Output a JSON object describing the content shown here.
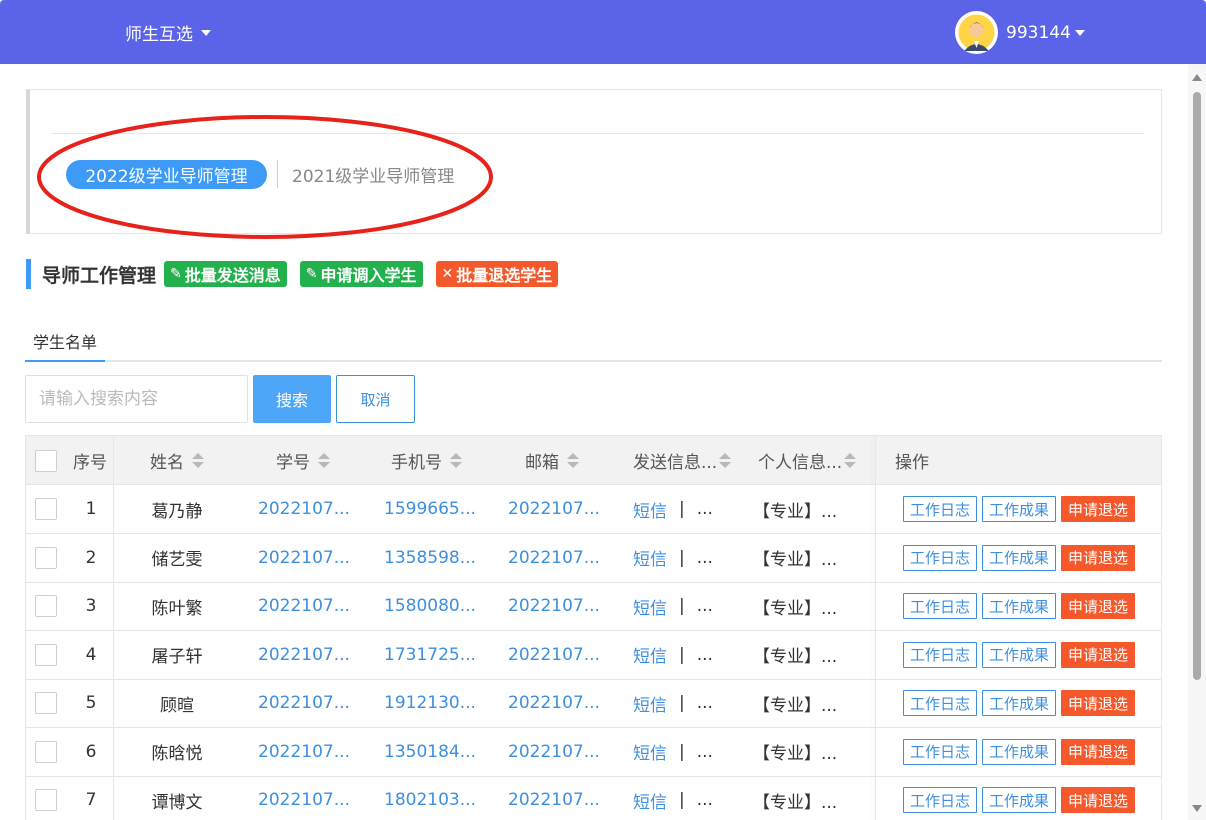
{
  "header": {
    "menu_label": "师生互选",
    "username": "993144",
    "brand_color": "#5b63e8"
  },
  "year_tabs": [
    {
      "label": "2022级学业导师管理",
      "active": true
    },
    {
      "label": "2021级学业导师管理",
      "active": false
    }
  ],
  "section": {
    "title": "导师工作管理",
    "actions": [
      {
        "label": "批量发送消息",
        "icon": "pencil-icon",
        "color": "#22b14c"
      },
      {
        "label": "申请调入学生",
        "icon": "pencil-icon",
        "color": "#22b14c"
      },
      {
        "label": "批量退选学生",
        "icon": "close-icon",
        "color": "#f5582a"
      }
    ]
  },
  "tabs": [
    {
      "label": "学生名单",
      "active": true
    }
  ],
  "search": {
    "placeholder": "请输入搜索内容",
    "value": "",
    "search_label": "搜索",
    "cancel_label": "取消"
  },
  "table": {
    "columns": [
      "序号",
      "姓名",
      "学号",
      "手机号",
      "邮箱",
      "发送信息...",
      "个人信息...",
      "操作"
    ],
    "sortable": [
      "姓名",
      "学号",
      "手机号",
      "邮箱",
      "发送信息...",
      "个人信息..."
    ],
    "rows": [
      {
        "no": "1",
        "name": "葛乃静",
        "student_id": "2022107...",
        "phone": "1599665...",
        "email": "2022107...",
        "msg_link": "短信",
        "msg_sep": "|",
        "msg_more": "...",
        "info": "【专业】..."
      },
      {
        "no": "2",
        "name": "储艺雯",
        "student_id": "2022107...",
        "phone": "1358598...",
        "email": "2022107...",
        "msg_link": "短信",
        "msg_sep": "|",
        "msg_more": "...",
        "info": "【专业】..."
      },
      {
        "no": "3",
        "name": "陈叶繁",
        "student_id": "2022107...",
        "phone": "1580080...",
        "email": "2022107...",
        "msg_link": "短信",
        "msg_sep": "|",
        "msg_more": "...",
        "info": "【专业】..."
      },
      {
        "no": "4",
        "name": "屠子轩",
        "student_id": "2022107...",
        "phone": "1731725...",
        "email": "2022107...",
        "msg_link": "短信",
        "msg_sep": "|",
        "msg_more": "...",
        "info": "【专业】..."
      },
      {
        "no": "5",
        "name": "顾暄",
        "student_id": "2022107...",
        "phone": "1912130...",
        "email": "2022107...",
        "msg_link": "短信",
        "msg_sep": "|",
        "msg_more": "...",
        "info": "【专业】..."
      },
      {
        "no": "6",
        "name": "陈晗悦",
        "student_id": "2022107...",
        "phone": "1350184...",
        "email": "2022107...",
        "msg_link": "短信",
        "msg_sep": "|",
        "msg_more": "...",
        "info": "【专业】..."
      },
      {
        "no": "7",
        "name": "谭博文",
        "student_id": "2022107...",
        "phone": "1802103...",
        "email": "2022107...",
        "msg_link": "短信",
        "msg_sep": "|",
        "msg_more": "...",
        "info": "【专业】..."
      }
    ],
    "row_actions": {
      "log": "工作日志",
      "result": "工作成果",
      "withdraw": "申请退选"
    }
  }
}
